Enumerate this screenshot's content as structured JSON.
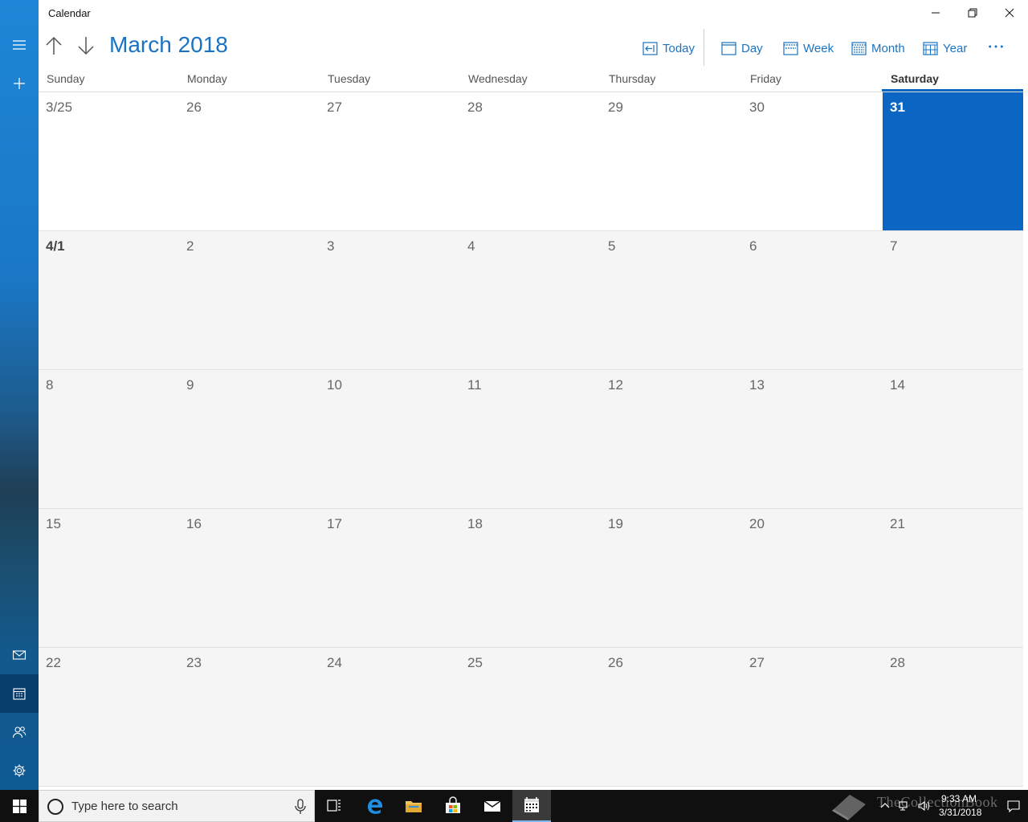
{
  "app": {
    "title": "Calendar"
  },
  "window_controls": {
    "minimize": "minimize-icon",
    "restore": "restore-icon",
    "close": "close-icon"
  },
  "header": {
    "month_title": "March 2018",
    "buttons": {
      "today": "Today",
      "day": "Day",
      "week": "Week",
      "month": "Month",
      "year": "Year"
    }
  },
  "days": [
    "Sunday",
    "Monday",
    "Tuesday",
    "Wednesday",
    "Thursday",
    "Friday",
    "Saturday"
  ],
  "weeks": [
    [
      "3/25",
      "26",
      "27",
      "28",
      "29",
      "30",
      "31"
    ],
    [
      "4/1",
      "2",
      "3",
      "4",
      "5",
      "6",
      "7"
    ],
    [
      "8",
      "9",
      "10",
      "11",
      "12",
      "13",
      "14"
    ],
    [
      "15",
      "16",
      "17",
      "18",
      "19",
      "20",
      "21"
    ],
    [
      "22",
      "23",
      "24",
      "25",
      "26",
      "27",
      "28"
    ]
  ],
  "today": {
    "week": 0,
    "day": 6
  },
  "taskbar": {
    "search_placeholder": "Type here to search",
    "time": "9:33 AM",
    "date": "3/31/2018",
    "watermark": "TheCollectionBook"
  },
  "colors": {
    "accent": "#0a66c2",
    "accent_text": "#1a73c2",
    "taskbar": "#101010"
  }
}
